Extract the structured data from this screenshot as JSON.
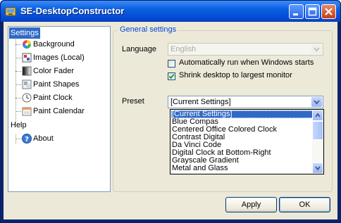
{
  "window": {
    "title": "SE-DesktopConstructor",
    "icons": [
      "app-icon",
      "minimize-icon",
      "maximize-icon",
      "close-icon"
    ]
  },
  "tree": {
    "items": [
      {
        "label": "Settings",
        "icon": ""
      },
      {
        "label": "Background",
        "icon": "color-wheel-icon"
      },
      {
        "label": "Images (Local)",
        "icon": "image-icon"
      },
      {
        "label": "Color Fader",
        "icon": "gradient-icon"
      },
      {
        "label": "Paint Shapes",
        "icon": "shapes-icon"
      },
      {
        "label": "Paint Clock",
        "icon": "clock-icon"
      },
      {
        "label": "Paint Calendar",
        "icon": "calendar-icon"
      },
      {
        "label": "Help",
        "icon": ""
      },
      {
        "label": "About",
        "icon": "help-icon"
      }
    ],
    "selected": "Settings"
  },
  "general": {
    "title": "General settings",
    "language_label": "Language",
    "language_value": "English",
    "autorun_label": "Automatically run when Windows starts",
    "autorun_checked": false,
    "shrink_label": "Shrink desktop to largest monitor",
    "shrink_checked": true,
    "preset_label": "Preset",
    "preset_value": "[Current Settings]",
    "preset_options": [
      "[Current Settings]",
      "Blue Compas",
      "Centered Office Colored Clock",
      "Contrast Digital",
      "Da Vinci Code",
      "Digital Clock at Bottom-Right",
      "Grayscale Gradient",
      "Metal and Glass"
    ]
  },
  "buttons": {
    "apply": "Apply",
    "ok": "OK"
  },
  "colors": {
    "titlebar": "#0a5fe0",
    "selection": "#316ac5",
    "group_title": "#0046d5",
    "face": "#ece9d8"
  }
}
